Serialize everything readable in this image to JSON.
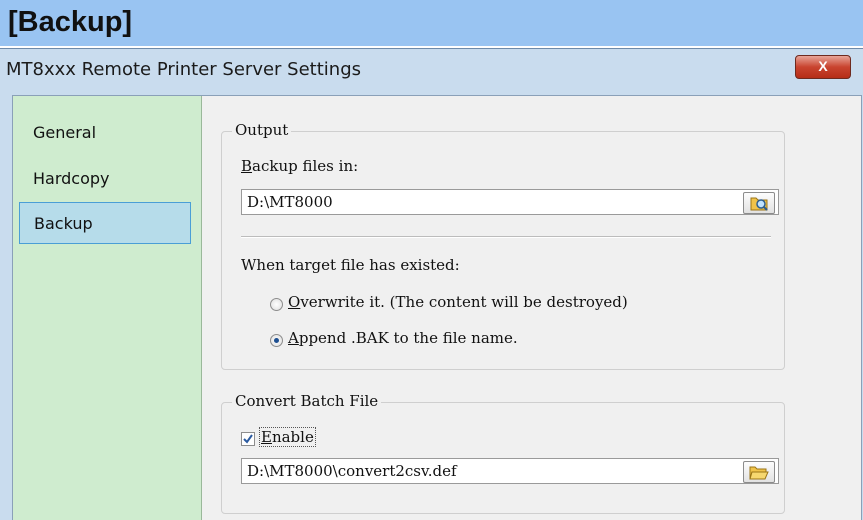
{
  "header": {
    "title": "[Backup]"
  },
  "window": {
    "title": "MT8xxx Remote Printer Server Settings",
    "close_label": "X"
  },
  "nav": {
    "items": [
      {
        "label": "General"
      },
      {
        "label": "Hardcopy"
      },
      {
        "label": "Backup"
      }
    ],
    "selected": "Backup"
  },
  "output": {
    "group_label": "Output",
    "backup_label_u": "B",
    "backup_label_rest": "ackup files in:",
    "backup_path": "D:\\MT8000",
    "existing_label": "When target file has existed:",
    "option1_u": "O",
    "option1_rest": "verwrite it. (The content will be destroyed)",
    "option2_u": "A",
    "option2_rest": "ppend .BAK to the file name.",
    "selected_option": "append"
  },
  "convert": {
    "group_label": "Convert Batch File",
    "enable_u": "E",
    "enable_rest": "nable",
    "enabled": true,
    "path": "D:\\MT8000\\convert2csv.def"
  },
  "icons": {
    "browse_output": "folder-search-icon",
    "browse_convert": "folder-open-icon"
  }
}
